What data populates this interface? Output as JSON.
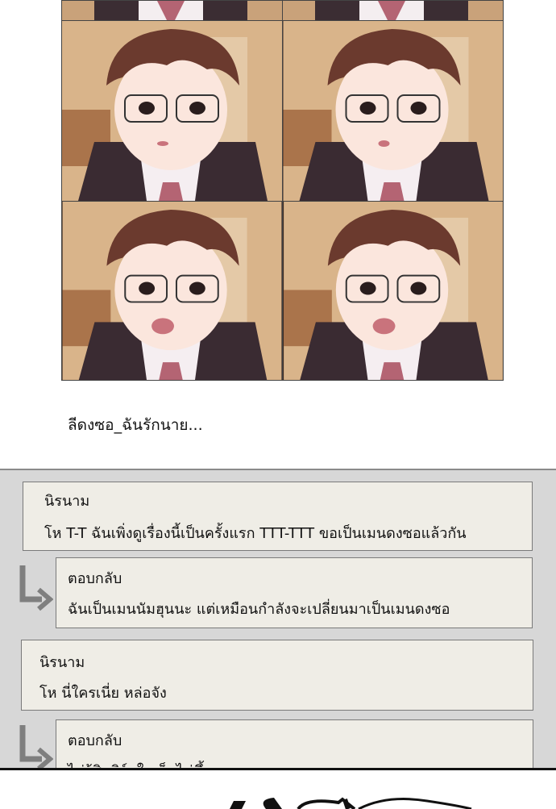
{
  "caption": "ลีดงซอ_ฉันรักนาย...",
  "comments": [
    {
      "type": "comment",
      "name": "นิรนาม",
      "text": "โห T-T ฉันเพิ่งดูเรื่องนี้เป็นครั้งแรก TTT-TTT ขอเป็นเมนดงซอแล้วกัน"
    },
    {
      "type": "reply",
      "name": "ตอบกลับ",
      "text": "ฉันเป็นเมนนัมฮุนนะ แต่เหมือนกำลังจะเปลี่ยนมาเป็นเมนดงซอ"
    },
    {
      "type": "comment",
      "name": "นิรนาม",
      "text": "โห นี่ใครเนี่ย หล่อจัง"
    },
    {
      "type": "reply",
      "name": "ตอบกลับ",
      "text": "ไม่รู้สิ เลิร์ดในเว็บไม่ขึ้นเลย"
    }
  ],
  "colors": {
    "comment_bg": "#d7d7d7",
    "box_bg": "#efede6",
    "border": "#7a7a7a"
  }
}
